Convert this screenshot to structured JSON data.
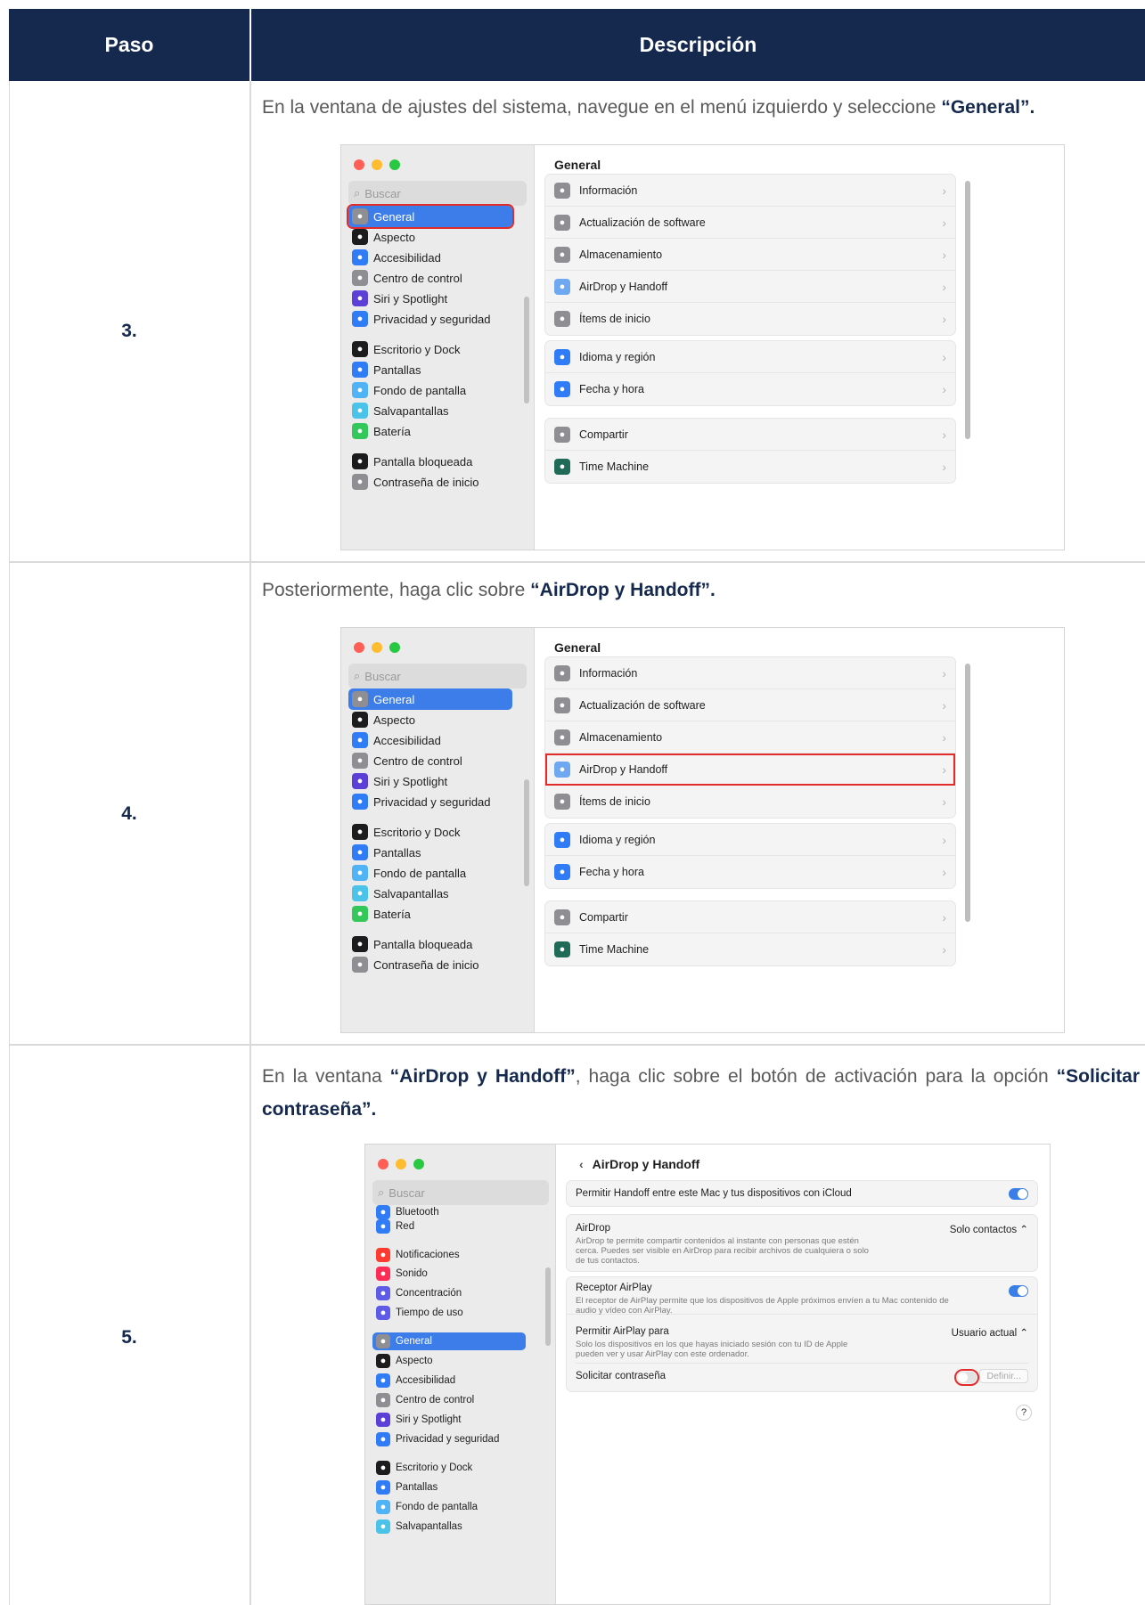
{
  "table": {
    "header": {
      "step": "Paso",
      "description": "Descripción"
    },
    "rows": [
      {
        "step": "3.",
        "text_before": "En la ventana de ajustes del sistema, navegue en el menú izquierdo y seleccione ",
        "text_bold": "“General”."
      },
      {
        "step": "4.",
        "text_before": "Posteriormente, haga clic sobre ",
        "text_bold": "“AirDrop y Handoff”."
      },
      {
        "step": "5.",
        "text_p1": "En la ventana ",
        "text_b1": "“AirDrop y Handoff”",
        "text_p2": ", haga clic sobre el botón de activación para la opción ",
        "text_b2": "“Solicitar contraseña”."
      }
    ]
  },
  "settings_a": {
    "search_placeholder": "Buscar",
    "title": "General",
    "sidebar": [
      {
        "label": "General",
        "icon": "gear-icon",
        "color": "#8e8e93"
      },
      {
        "label": "Aspecto",
        "icon": "appearance-icon",
        "color": "#1c1c1e"
      },
      {
        "label": "Accesibilidad",
        "icon": "accessibility-icon",
        "color": "#2f7cf6"
      },
      {
        "label": "Centro de control",
        "icon": "control-center-icon",
        "color": "#8e8e93"
      },
      {
        "label": "Siri y Spotlight",
        "icon": "siri-icon",
        "color": "#5b3fd6"
      },
      {
        "label": "Privacidad y seguridad",
        "icon": "hand-icon",
        "color": "#2f7cf6"
      },
      {
        "label": "Escritorio y Dock",
        "icon": "dock-icon",
        "color": "#1c1c1e"
      },
      {
        "label": "Pantallas",
        "icon": "display-icon",
        "color": "#2f7cf6"
      },
      {
        "label": "Fondo de pantalla",
        "icon": "wallpaper-icon",
        "color": "#4fb3f5"
      },
      {
        "label": "Salvapantallas",
        "icon": "screensaver-icon",
        "color": "#4bc2e8"
      },
      {
        "label": "Batería",
        "icon": "battery-icon",
        "color": "#34c759"
      },
      {
        "label": "Pantalla bloqueada",
        "icon": "lock-icon",
        "color": "#1c1c1e"
      },
      {
        "label": "Contraseña de inicio",
        "icon": "key-icon",
        "color": "#8e8e93"
      }
    ],
    "groups": [
      [
        {
          "label": "Información",
          "icon": "laptop-icon",
          "color": "#8e8e93"
        },
        {
          "label": "Actualización de software",
          "icon": "update-icon",
          "color": "#8e8e93"
        },
        {
          "label": "Almacenamiento",
          "icon": "storage-icon",
          "color": "#8e8e93"
        },
        {
          "label": "AirDrop y Handoff",
          "icon": "airdrop-icon",
          "color": "#6ea8f0"
        },
        {
          "label": "Ítems de inicio",
          "icon": "list-icon",
          "color": "#8e8e93"
        }
      ],
      [
        {
          "label": "Idioma y región",
          "icon": "globe-icon",
          "color": "#2f7cf6"
        },
        {
          "label": "Fecha y hora",
          "icon": "calendar-icon",
          "color": "#2f7cf6"
        }
      ],
      [
        {
          "label": "Compartir",
          "icon": "share-icon",
          "color": "#8e8e93"
        },
        {
          "label": "Time Machine",
          "icon": "time-machine-icon",
          "color": "#1f6b57"
        }
      ]
    ]
  },
  "settings_b": {
    "search_placeholder": "Buscar",
    "title": "AirDrop y Handoff",
    "sidebar": [
      {
        "label": "Bluetooth",
        "icon": "bluetooth-icon",
        "color": "#2f7cf6"
      },
      {
        "label": "Red",
        "icon": "network-icon",
        "color": "#2f7cf6"
      },
      {
        "label": "Notificaciones",
        "icon": "bell-icon",
        "color": "#ff3b30"
      },
      {
        "label": "Sonido",
        "icon": "speaker-icon",
        "color": "#ff2d55"
      },
      {
        "label": "Concentración",
        "icon": "moon-icon",
        "color": "#5e5ce6"
      },
      {
        "label": "Tiempo de uso",
        "icon": "hourglass-icon",
        "color": "#5e5ce6"
      },
      {
        "label": "General",
        "icon": "gear-icon",
        "color": "#8e8e93"
      },
      {
        "label": "Aspecto",
        "icon": "appearance-icon",
        "color": "#1c1c1e"
      },
      {
        "label": "Accesibilidad",
        "icon": "accessibility-icon",
        "color": "#2f7cf6"
      },
      {
        "label": "Centro de control",
        "icon": "control-center-icon",
        "color": "#8e8e93"
      },
      {
        "label": "Siri y Spotlight",
        "icon": "siri-icon",
        "color": "#5b3fd6"
      },
      {
        "label": "Privacidad y seguridad",
        "icon": "hand-icon",
        "color": "#2f7cf6"
      },
      {
        "label": "Escritorio y Dock",
        "icon": "dock-icon",
        "color": "#1c1c1e"
      },
      {
        "label": "Pantallas",
        "icon": "display-icon",
        "color": "#2f7cf6"
      },
      {
        "label": "Fondo de pantalla",
        "icon": "wallpaper-icon",
        "color": "#4fb3f5"
      },
      {
        "label": "Salvapantallas",
        "icon": "screensaver-icon",
        "color": "#4bc2e8"
      }
    ],
    "handoff_label": "Permitir Handoff entre este Mac y tus dispositivos con iCloud",
    "airdrop_label": "AirDrop",
    "airdrop_value": "Solo contactos ⌃",
    "airdrop_desc": "AirDrop te permite compartir contenidos al instante con personas que estén cerca. Puedes ser visible en AirDrop para recibir archivos de cualquiera o solo de tus contactos.",
    "receiver_label": "Receptor AirPlay",
    "receiver_desc": "El receptor de AirPlay permite que los dispositivos de Apple próximos envíen a tu Mac contenido de audio y vídeo con AirPlay.",
    "allow_label": "Permitir AirPlay para",
    "allow_value": "Usuario actual ⌃",
    "allow_desc": "Solo los dispositivos en los que hayas iniciado sesión con tu ID de Apple pueden ver y usar AirPlay con este ordenador.",
    "password_label": "Solicitar contraseña",
    "define_button": "Definir...",
    "help": "?"
  },
  "colors": {
    "header_bg": "#15294e",
    "highlight": "#e22b2b",
    "accent": "#3d7de9"
  }
}
